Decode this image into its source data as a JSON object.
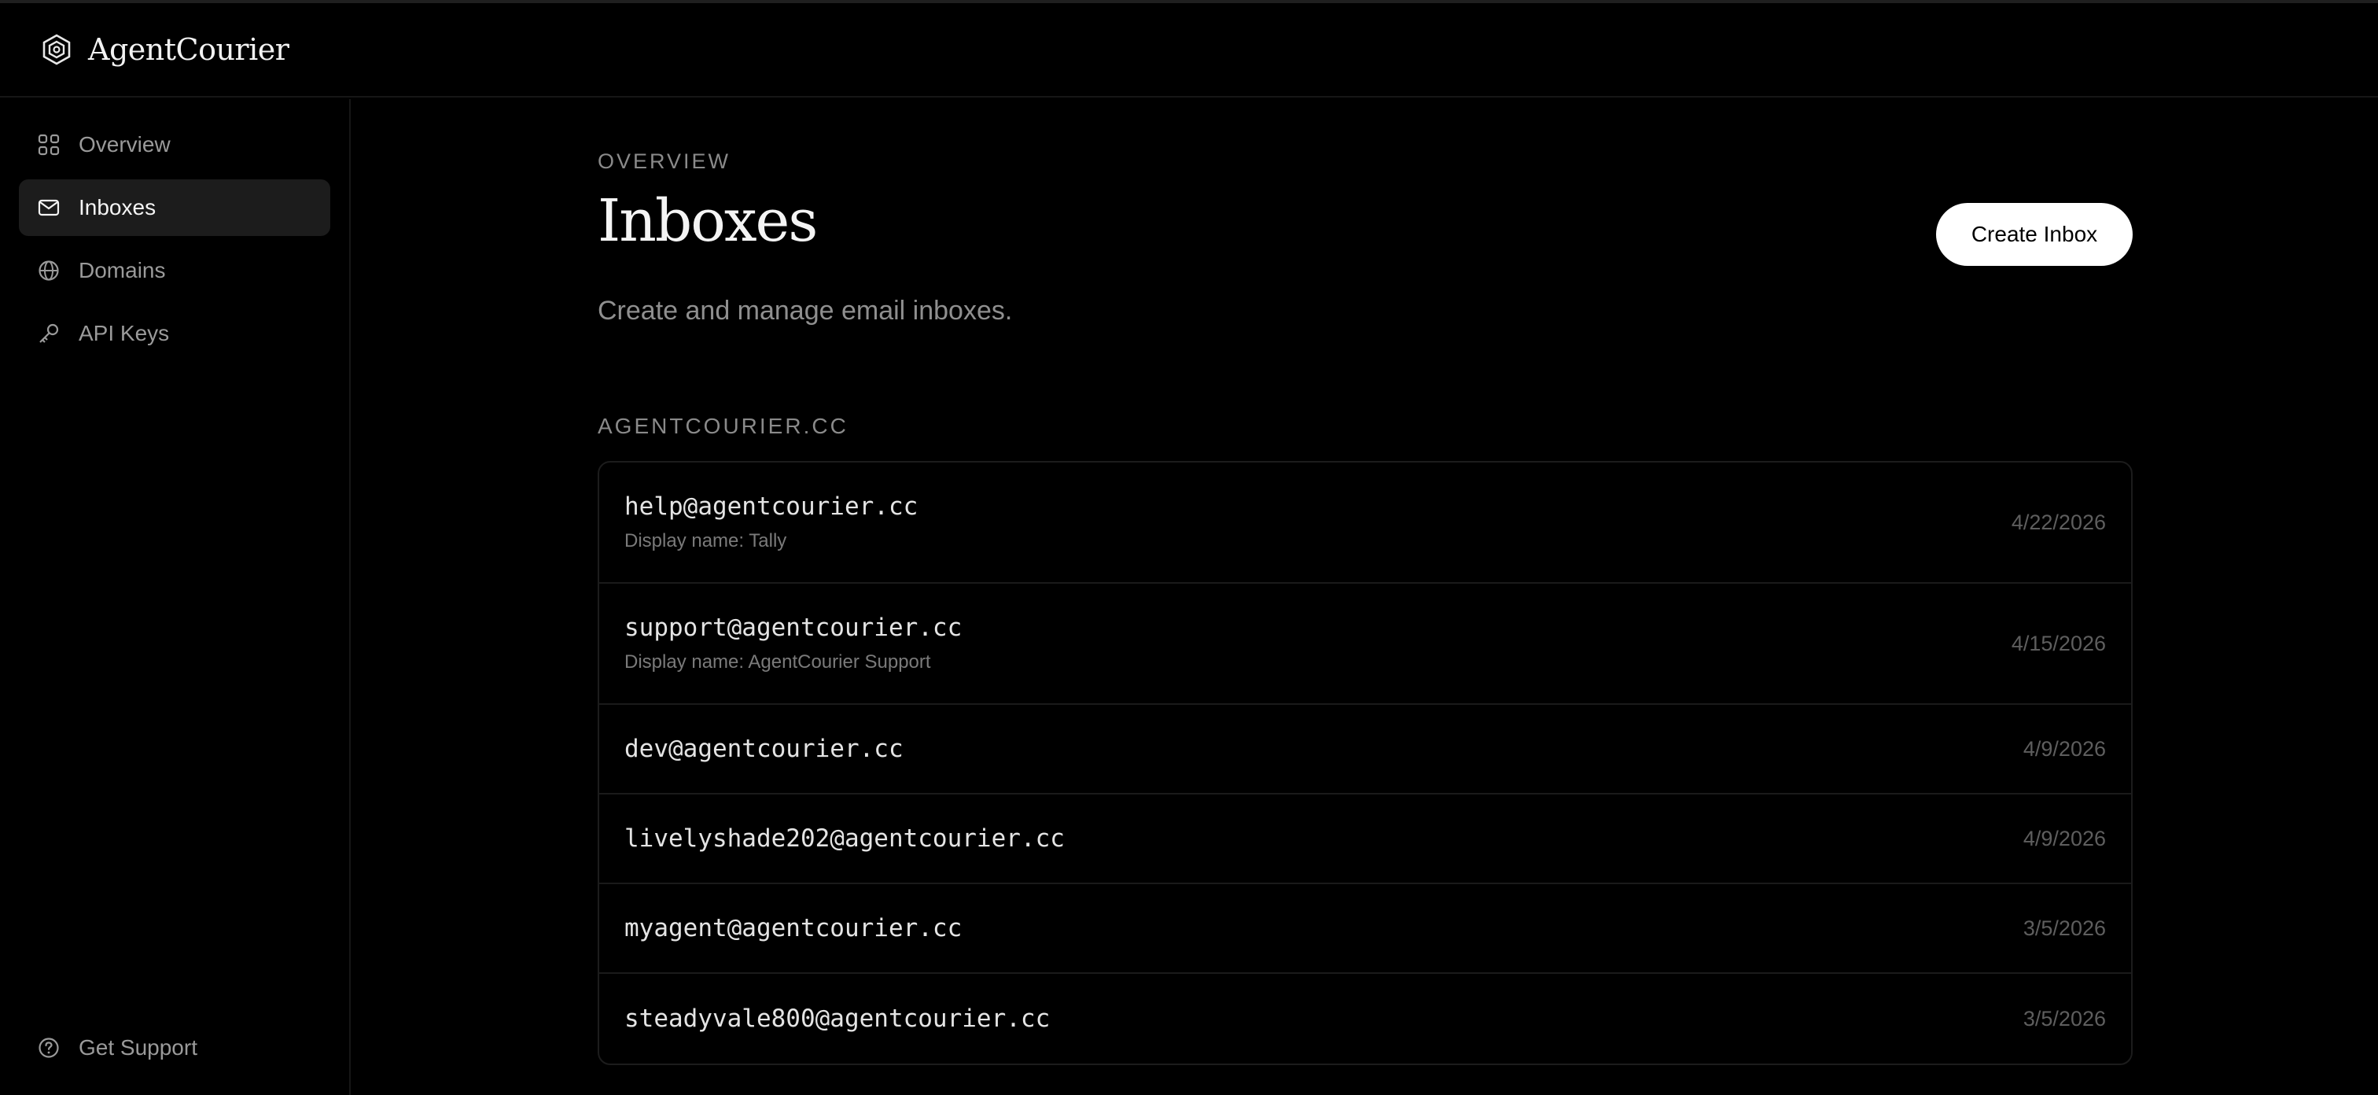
{
  "app": {
    "name": "AgentCourier",
    "logo_icon": "hexagon-logo-icon"
  },
  "sidebar": {
    "items": [
      {
        "label": "Overview",
        "icon": "grid-icon",
        "active": false
      },
      {
        "label": "Inboxes",
        "icon": "mail-icon",
        "active": true
      },
      {
        "label": "Domains",
        "icon": "globe-icon",
        "active": false
      },
      {
        "label": "API Keys",
        "icon": "key-icon",
        "active": false
      }
    ],
    "footer": {
      "label": "Get Support",
      "icon": "help-circle-icon"
    }
  },
  "main": {
    "eyebrow": "OVERVIEW",
    "title": "Inboxes",
    "subtitle": "Create and manage email inboxes.",
    "create_button": "Create Inbox",
    "group_label": "AGENTCOURIER.CC",
    "inboxes": [
      {
        "email": "help@agentcourier.cc",
        "display": "Display name: Tally",
        "date": "4/22/2026"
      },
      {
        "email": "support@agentcourier.cc",
        "display": "Display name: AgentCourier Support",
        "date": "4/15/2026"
      },
      {
        "email": "dev@agentcourier.cc",
        "display": "",
        "date": "4/9/2026"
      },
      {
        "email": "livelyshade202@agentcourier.cc",
        "display": "",
        "date": "4/9/2026"
      },
      {
        "email": "myagent@agentcourier.cc",
        "display": "",
        "date": "3/5/2026"
      },
      {
        "email": "steadyvale800@agentcourier.cc",
        "display": "",
        "date": "3/5/2026"
      }
    ]
  },
  "colors": {
    "background": "#000000",
    "active_nav": "#1c1c1c",
    "primary_button": "#ffffff"
  }
}
